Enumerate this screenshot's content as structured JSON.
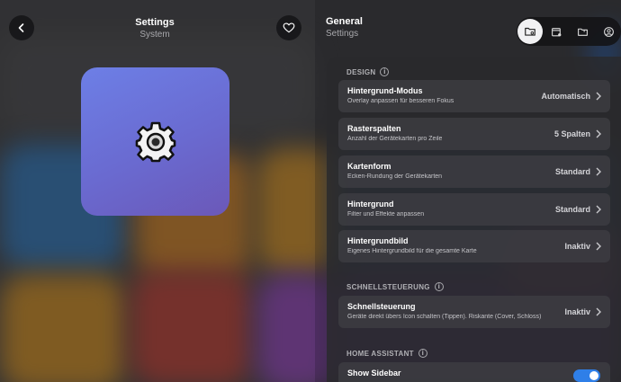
{
  "header": {
    "left_title": "Settings",
    "left_subtitle": "System",
    "right_title": "General",
    "right_subtitle": "Settings",
    "back_icon": "chevron-left-icon",
    "favorite_icon": "heart-icon",
    "icon_bar": [
      "folder-settings-icon",
      "calendar-settings-icon",
      "folder-icon",
      "account-circle-icon"
    ]
  },
  "tile": {
    "icon": "gear-icon",
    "colors": [
      "#6d7fe6",
      "#6b58b8"
    ]
  },
  "sections": {
    "design": "DESIGN",
    "quick": "SCHNELLSTEUERUNG",
    "ha": "HOME ASSISTANT"
  },
  "rows": [
    {
      "title": "Hintergrund-Modus",
      "subtitle": "Overlay anpassen für besseren Fokus",
      "value": "Automatisch"
    },
    {
      "title": "Rasterspalten",
      "subtitle": "Anzahl der Gerätekarten pro Zeile",
      "value": "5 Spalten"
    },
    {
      "title": "Kartenform",
      "subtitle": "Ecken-Rundung der Gerätekarten",
      "value": "Standard"
    },
    {
      "title": "Hintergrund",
      "subtitle": "Filter und Effekte anpassen",
      "value": "Standard"
    },
    {
      "title": "Hintergrundbild",
      "subtitle": "Eigenes Hintergrundbild für die gesamte Karte",
      "value": "Inaktiv"
    },
    {
      "title": "Schnellsteuerung",
      "subtitle": "Geräte direkt übers Icon schalten (Tippen). Riskante (Cover, Schloss)",
      "value": "Inaktiv"
    },
    {
      "title": "Show Sidebar",
      "toggle_on": true
    }
  ],
  "accent": "#2f7fe8"
}
